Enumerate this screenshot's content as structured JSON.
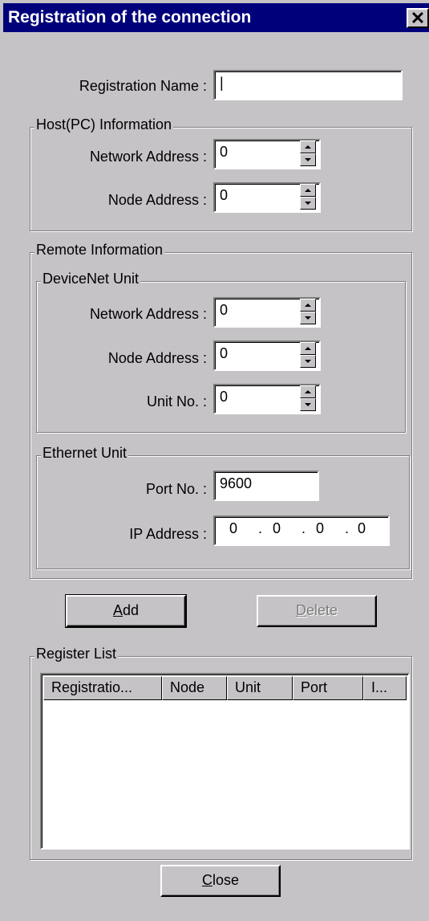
{
  "window": {
    "title": "Registration of the connection",
    "close_glyph": "✕"
  },
  "registration": {
    "label": "Registration Name :",
    "value": "|"
  },
  "host": {
    "group_title": "Host(PC) Information",
    "network_label": "Network Address :",
    "network_value": "0",
    "node_label": "Node Address :",
    "node_value": "0"
  },
  "remote": {
    "group_title": "Remote Information",
    "devicenet": {
      "group_title": "DeviceNet Unit",
      "network_label": "Network Address :",
      "network_value": "0",
      "node_label": "Node Address :",
      "node_value": "0",
      "unit_label": "Unit No. :",
      "unit_value": "0"
    },
    "ethernet": {
      "group_title": "Ethernet Unit",
      "port_label": "Port No. :",
      "port_value": "9600",
      "ip_label": "IP Address :",
      "ip_octets": [
        "0",
        "0",
        "0",
        "0"
      ],
      "ip_separator": "."
    }
  },
  "buttons": {
    "add_mnemonic": "A",
    "add_rest": "dd",
    "delete_mnemonic": "D",
    "delete_rest": "elete",
    "close_mnemonic": "C",
    "close_rest": "lose"
  },
  "register_list": {
    "group_title": "Register List",
    "columns": [
      "Registratio...",
      "Node",
      "Unit",
      "Port",
      "I..."
    ]
  },
  "icons": [
    "close-icon",
    "spin-up-icon",
    "spin-down-icon"
  ]
}
